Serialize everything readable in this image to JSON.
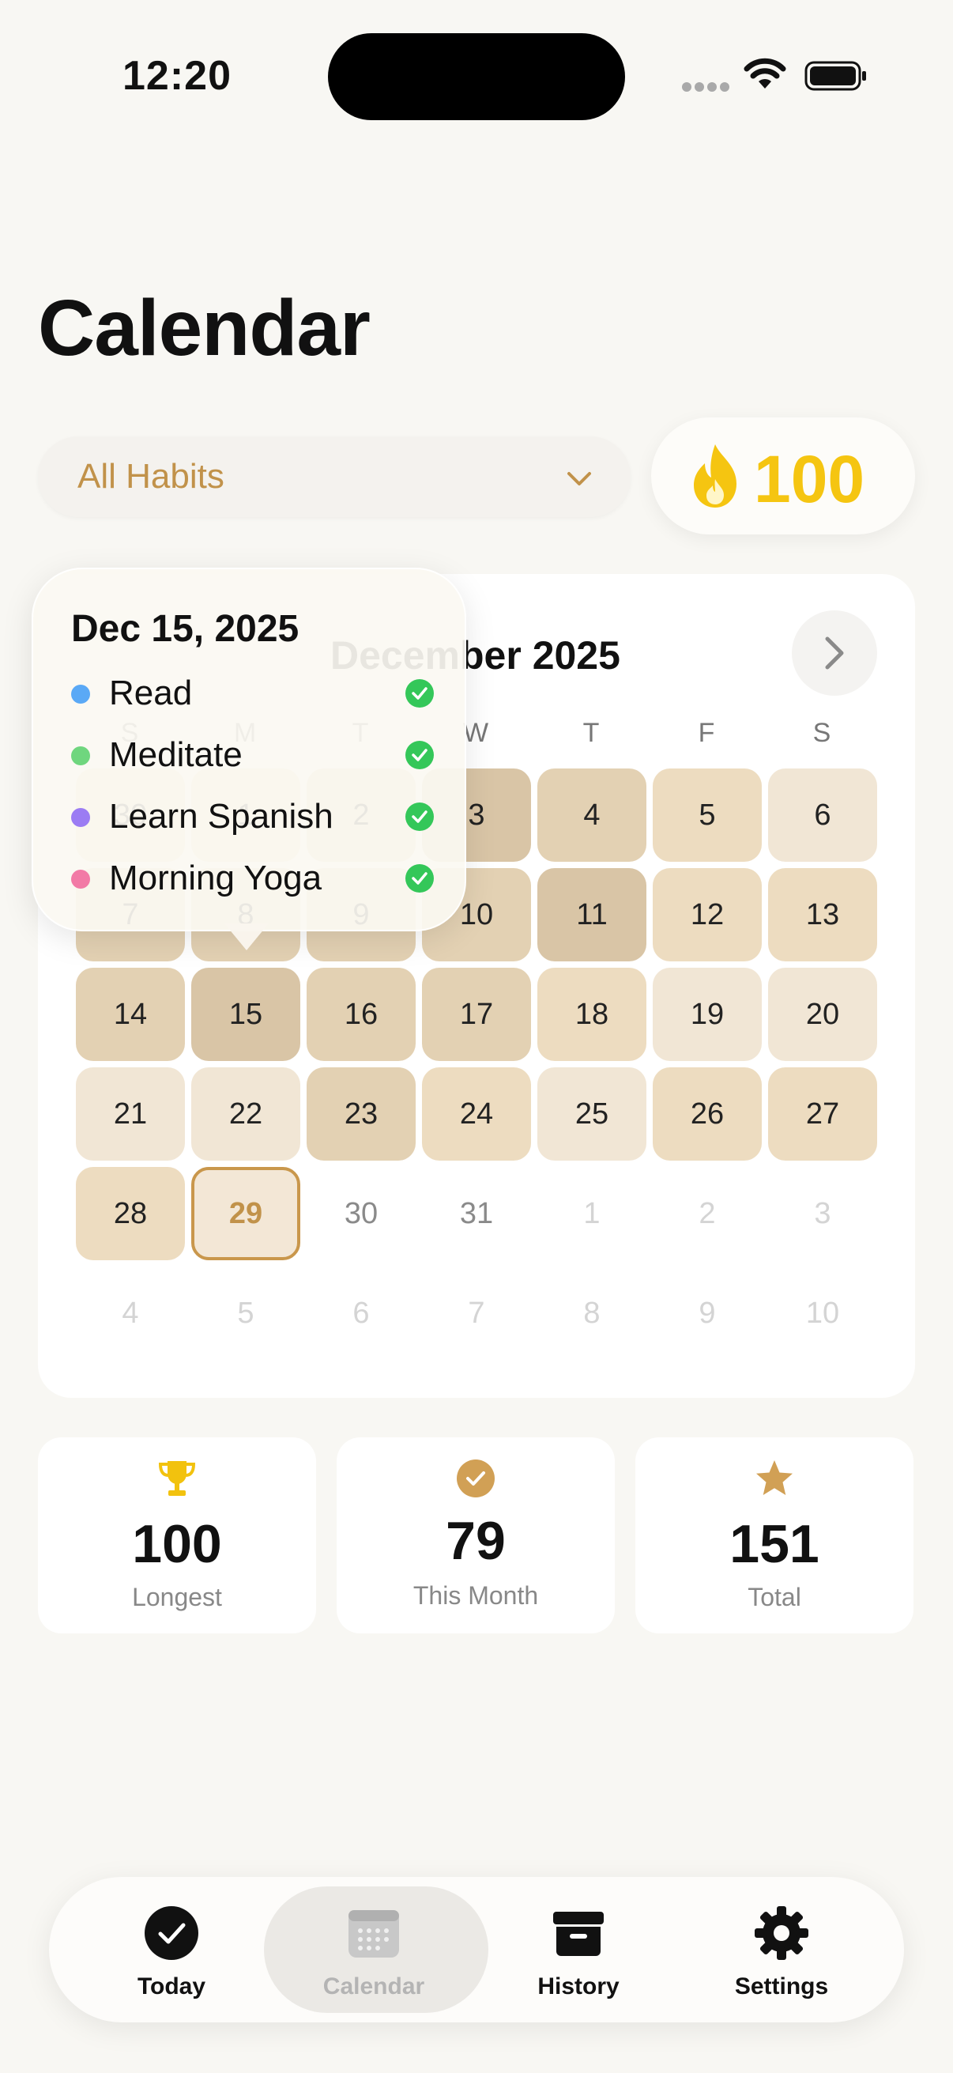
{
  "status_bar": {
    "time": "12:20"
  },
  "page": {
    "title": "Calendar"
  },
  "filter": {
    "label": "All Habits"
  },
  "streak": {
    "value": "100"
  },
  "calendar": {
    "month_title": "December 2025",
    "weekdays": [
      "S",
      "M",
      "T",
      "W",
      "T",
      "F",
      "S"
    ],
    "rows": [
      [
        "30",
        "1",
        "2",
        "3",
        "4",
        "5",
        "6"
      ],
      [
        "7",
        "8",
        "9",
        "10",
        "11",
        "12",
        "13"
      ],
      [
        "14",
        "15",
        "16",
        "17",
        "18",
        "19",
        "20"
      ],
      [
        "21",
        "22",
        "23",
        "24",
        "25",
        "26",
        "27"
      ],
      [
        "28",
        "29",
        "30",
        "31",
        "1",
        "2",
        "3"
      ],
      [
        "4",
        "5",
        "6",
        "7",
        "8",
        "9",
        "10"
      ]
    ],
    "today": "29"
  },
  "popover": {
    "date": "Dec 15, 2025",
    "habits": [
      {
        "name": "Read",
        "color": "#5aa9f6"
      },
      {
        "name": "Meditate",
        "color": "#6fd67e"
      },
      {
        "name": "Learn Spanish",
        "color": "#9b7cf3"
      },
      {
        "name": "Morning Yoga",
        "color": "#f27aa6"
      }
    ]
  },
  "stats": [
    {
      "value": "100",
      "label": "Longest",
      "icon": "trophy-icon",
      "color": "#f2c20e"
    },
    {
      "value": "79",
      "label": "This Month",
      "icon": "checkmark-circle-icon",
      "color": "#d1a055"
    },
    {
      "value": "151",
      "label": "Total",
      "icon": "star-icon",
      "color": "#d1a055"
    }
  ],
  "tabs": [
    {
      "label": "Today",
      "icon": "checkmark-circle-icon"
    },
    {
      "label": "Calendar",
      "icon": "calendar-icon",
      "active": true
    },
    {
      "label": "History",
      "icon": "archive-box-icon"
    },
    {
      "label": "Settings",
      "icon": "gear-icon"
    }
  ],
  "colors": {
    "accent": "#c1924a",
    "streak": "#f5c511",
    "check_green": "#34c759"
  }
}
